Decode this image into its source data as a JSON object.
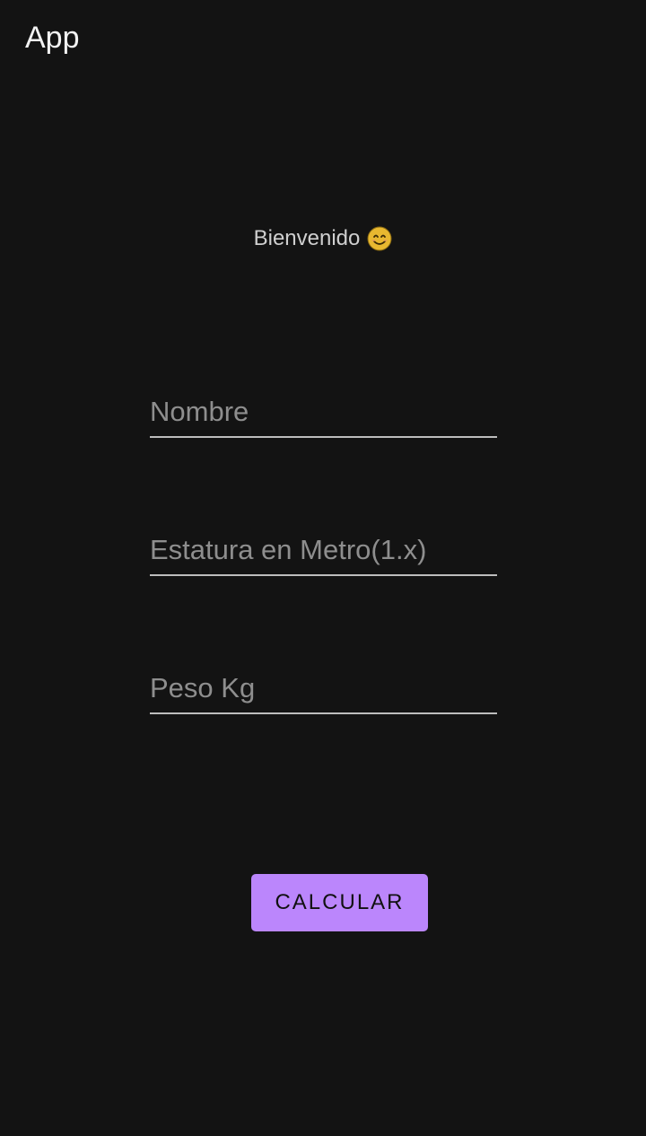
{
  "app_bar": {
    "title": "App"
  },
  "welcome": {
    "text": "Bienvenido",
    "emoji_icon": "smiling-face-icon"
  },
  "form": {
    "name_placeholder": "Nombre",
    "height_placeholder": "Estatura en Metro(1.x)",
    "weight_placeholder": "Peso Kg"
  },
  "actions": {
    "calculate_label": "CALCULAR"
  },
  "colors": {
    "background": "#131313",
    "accent": "#bb86fc",
    "field_underline": "#bdbdbd",
    "placeholder": "#8e8e8e"
  }
}
